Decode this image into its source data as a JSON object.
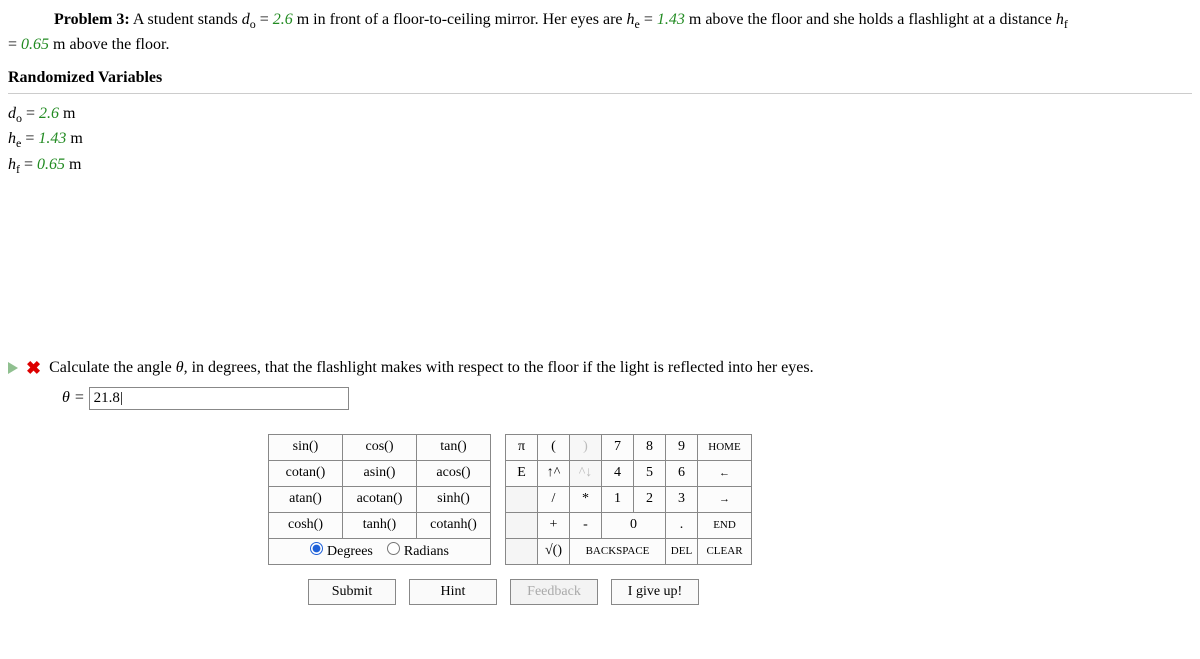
{
  "problem": {
    "label": "Problem 3:",
    "text_part1": "A student stands ",
    "var_do": "d",
    "var_do_sub": "o",
    "eq_do": " = ",
    "val_do": "2.6",
    "text_part2": " m in front of a floor-to-ceiling mirror. Her eyes are ",
    "var_he": "h",
    "var_he_sub": "e",
    "eq_he": " = ",
    "val_he": "1.43",
    "text_part3": " m above the floor and she holds a flashlight at a distance ",
    "var_hf": "h",
    "var_hf_sub": "f",
    "text_part4_pre": " = ",
    "val_hf": "0.65",
    "text_part4_post": " m above the floor."
  },
  "randomized_label": "Randomized Variables",
  "vars": {
    "do_line_pre": "d",
    "do_sub": "o",
    "do_eq": " = ",
    "do_val": "2.6",
    "do_unit": " m",
    "he_line_pre": "h",
    "he_sub": "e",
    "he_eq": " = ",
    "he_val": "1.43",
    "he_unit": " m",
    "hf_line_pre": "h",
    "hf_sub": "f",
    "hf_eq": " = ",
    "hf_val": "0.65",
    "hf_unit": " m"
  },
  "question": {
    "text_pre": "Calculate the angle ",
    "theta": "θ",
    "text_post": ", in degrees, that the flashlight makes with respect to the floor if the light is reflected into her eyes."
  },
  "answer": {
    "theta_eq": "θ = ",
    "value": "21.8|"
  },
  "fn": {
    "r1c1": "sin()",
    "r1c2": "cos()",
    "r1c3": "tan()",
    "r2c1": "cotan()",
    "r2c2": "asin()",
    "r2c3": "acos()",
    "r3c1": "atan()",
    "r3c2": "acotan()",
    "r3c3": "sinh()",
    "r4c1": "cosh()",
    "r4c2": "tanh()",
    "r4c3": "cotanh()"
  },
  "mode": {
    "degrees": "Degrees",
    "radians": "Radians"
  },
  "kp": {
    "pi": "π",
    "lpar": "(",
    "rpar": ")",
    "n7": "7",
    "n8": "8",
    "n9": "9",
    "home": "HOME",
    "E": "E",
    "up": "↑^",
    "upd": "^↓",
    "n4": "4",
    "n5": "5",
    "n6": "6",
    "left": "←",
    "slash": "/",
    "star": "*",
    "n1": "1",
    "n2": "2",
    "n3": "3",
    "right": "→",
    "plus": "+",
    "minus": "-",
    "n0": "0",
    "dot": ".",
    "end": "END",
    "sqrt": "√()",
    "backspace": "BACKSPACE",
    "del": "DEL",
    "clear": "CLEAR"
  },
  "actions": {
    "submit": "Submit",
    "hint": "Hint",
    "feedback": "Feedback",
    "giveup": "I give up!"
  }
}
